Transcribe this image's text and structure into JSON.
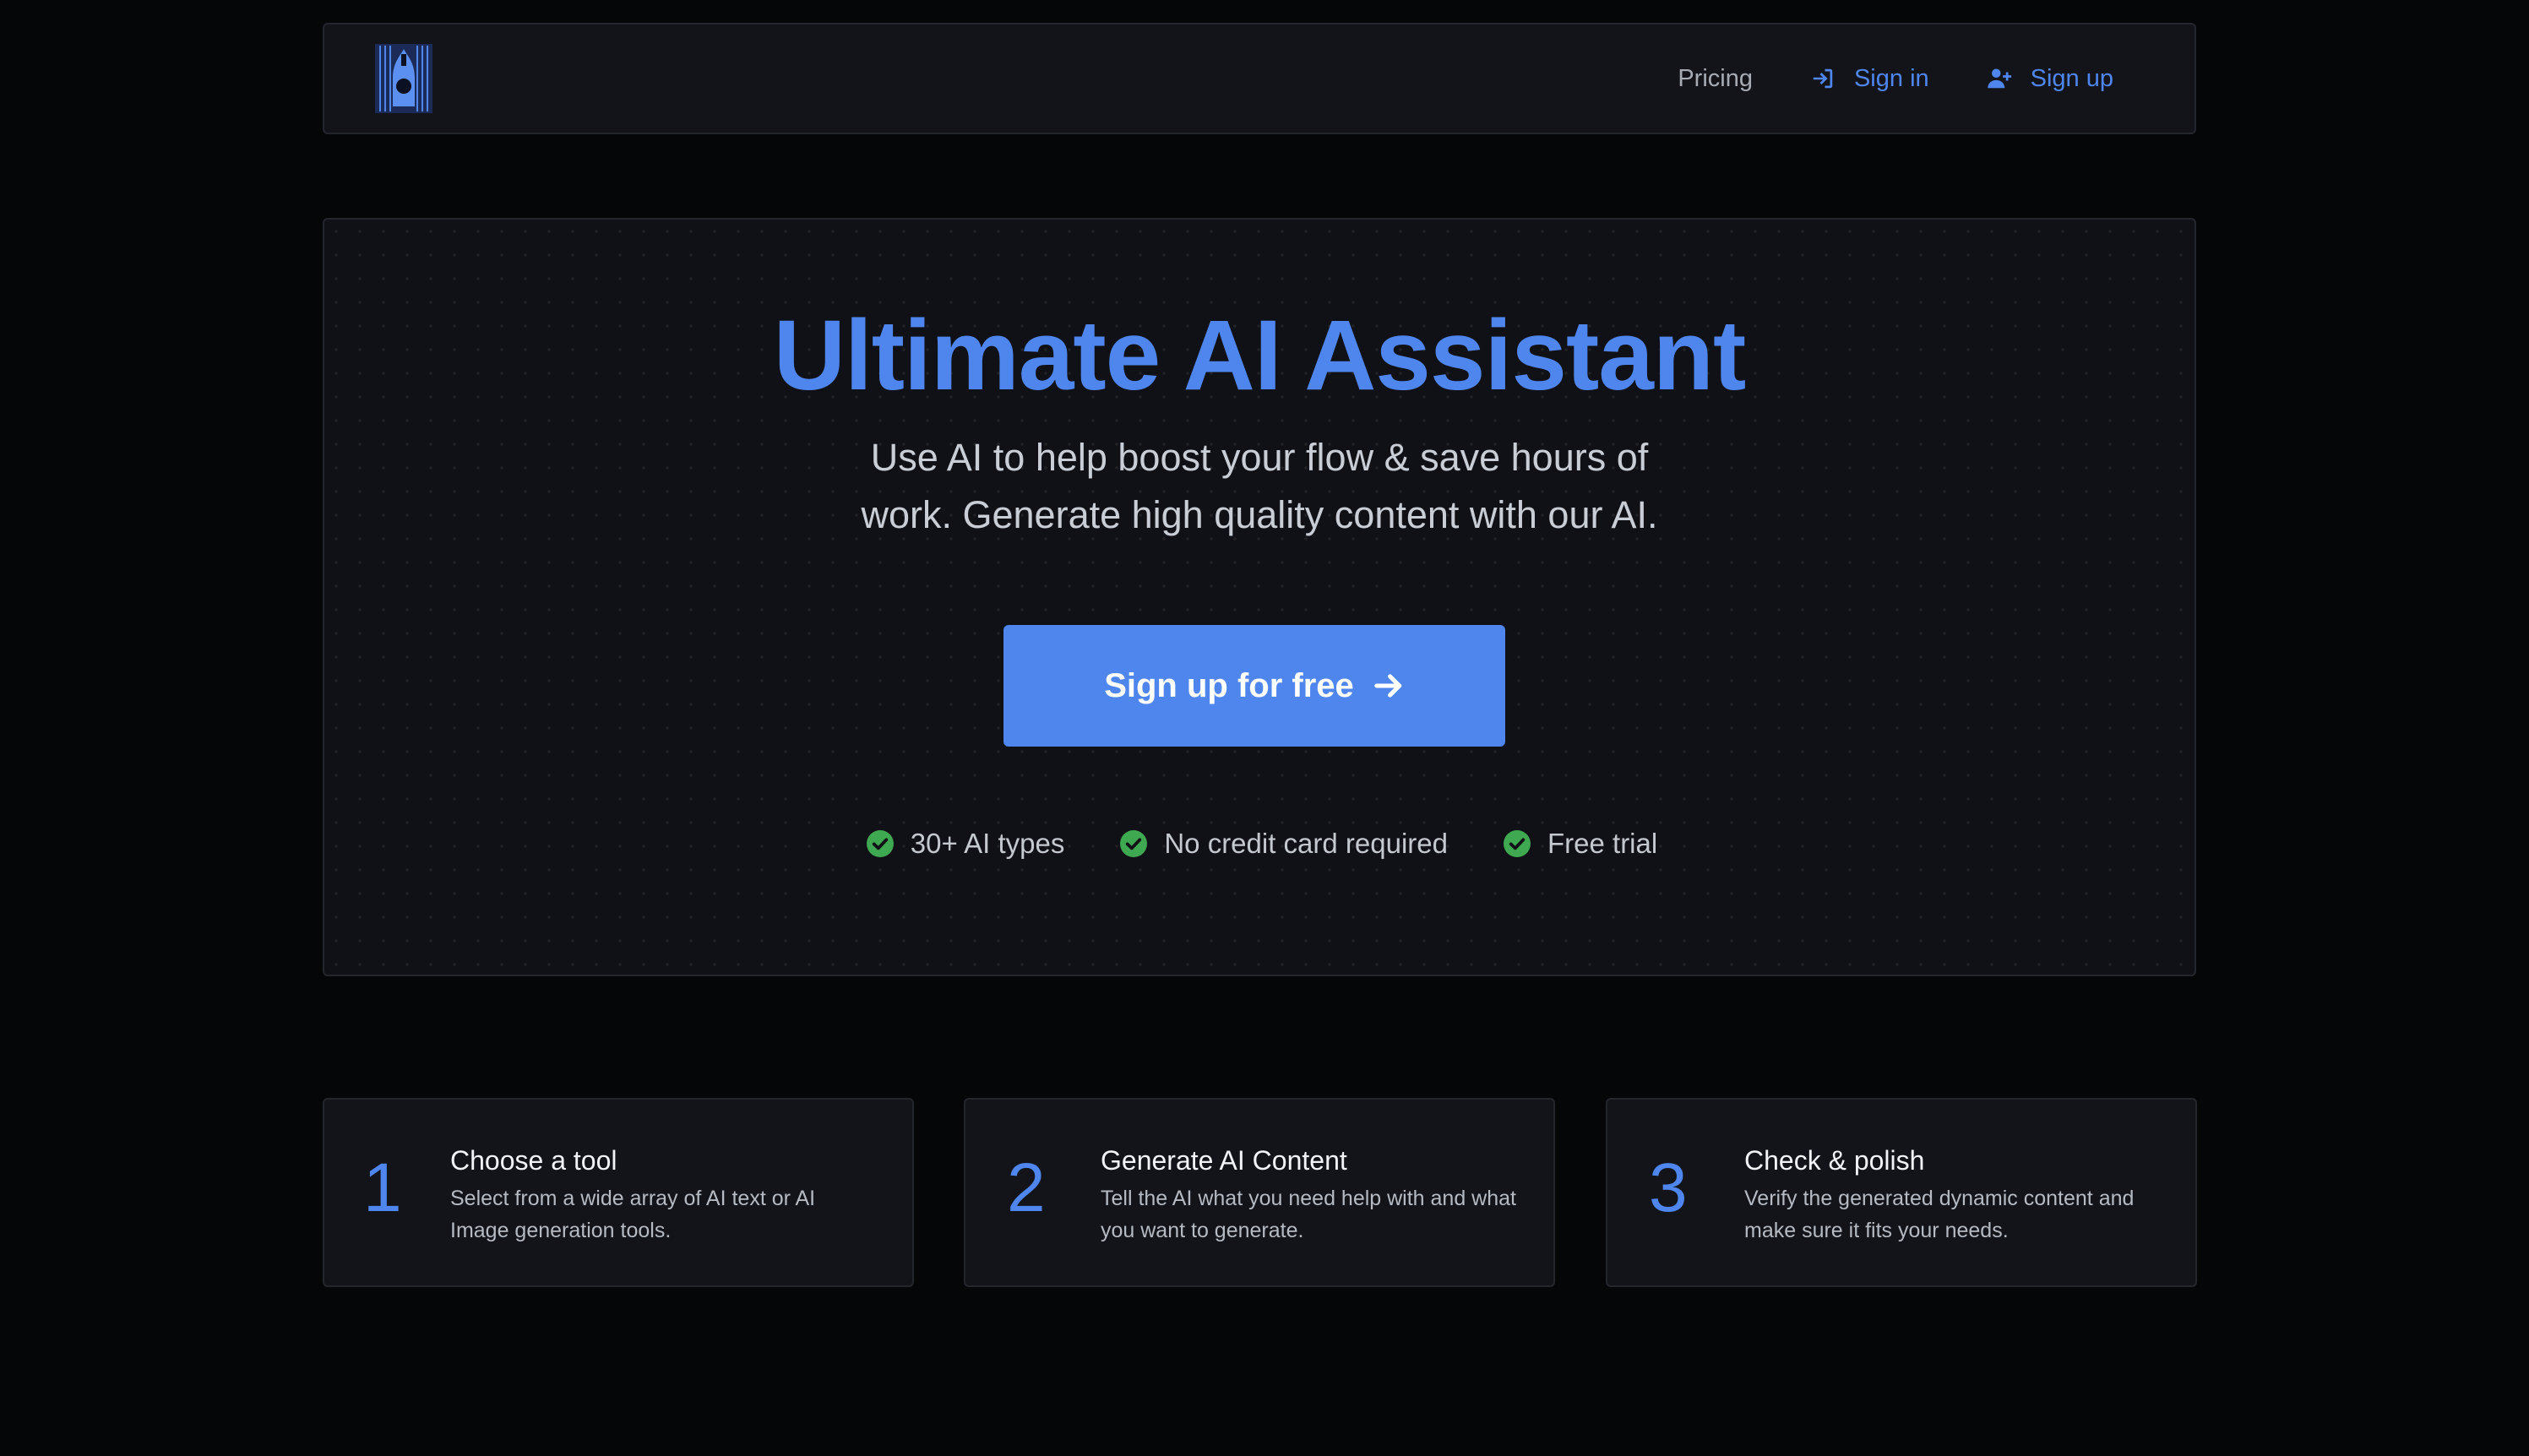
{
  "header": {
    "logo_name": "brand-logo",
    "nav": [
      {
        "label": "Pricing",
        "icon": ""
      },
      {
        "label": "Sign in",
        "icon": "sign-in-icon"
      },
      {
        "label": "Sign up",
        "icon": "user-plus-icon"
      }
    ]
  },
  "hero": {
    "title": "Ultimate AI Assistant",
    "subtitle": "Use AI to help boost your flow & save hours of work. Generate high quality content with our AI.",
    "cta_label": "Sign up for free",
    "cta_icon": "arrow-right-icon",
    "features": [
      {
        "label": "30+ AI types",
        "icon": "check-circle-icon"
      },
      {
        "label": "No credit card required",
        "icon": "check-circle-icon"
      },
      {
        "label": "Free trial",
        "icon": "check-circle-icon"
      }
    ]
  },
  "steps": [
    {
      "number": "1",
      "title": "Choose a tool",
      "description": "Select from a wide array of AI text or AI Image generation tools."
    },
    {
      "number": "2",
      "title": "Generate AI Content",
      "description": "Tell the AI what you need help with and what you want to generate."
    },
    {
      "number": "3",
      "title": "Check & polish",
      "description": "Verify the generated dynamic content and make sure it fits your needs."
    }
  ],
  "colors": {
    "accent": "#4f86ee",
    "background": "#050608",
    "panel": "#121419",
    "success": "#3fa951"
  }
}
